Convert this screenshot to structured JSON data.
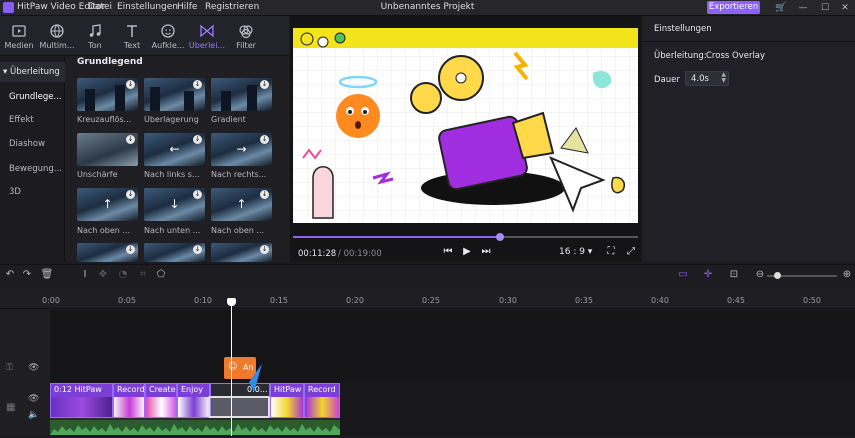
{
  "titlebar": {
    "app_name": "HitPaw Video Editor",
    "menu": [
      "Datei",
      "Einstellungen",
      "Hilfe",
      "Registrieren"
    ],
    "project_title": "Unbenanntes Projekt",
    "export_label": "Exportieren"
  },
  "media_tabs": [
    {
      "label": "Medien",
      "icon": "media-icon"
    },
    {
      "label": "Multim...",
      "icon": "globe-icon"
    },
    {
      "label": "Ton",
      "icon": "music-icon"
    },
    {
      "label": "Text",
      "icon": "text-icon"
    },
    {
      "label": "Aufkle...",
      "icon": "sticker-icon"
    },
    {
      "label": "Überlei...",
      "icon": "transition-icon"
    },
    {
      "label": "Filter",
      "icon": "filter-icon"
    }
  ],
  "categories": {
    "header": "Überleitung",
    "items": [
      "Grundlege...",
      "Effekt",
      "Diashow",
      "Bewegung...",
      "3D"
    ]
  },
  "grid": {
    "heading": "Grundlegend",
    "items": [
      {
        "label": "Kreuzauflös..."
      },
      {
        "label": "Überlagerung"
      },
      {
        "label": "Gradient"
      },
      {
        "label": "Unschärfe"
      },
      {
        "label": "Nach links s..."
      },
      {
        "label": "Nach rechts..."
      },
      {
        "label": "Nach oben ..."
      },
      {
        "label": "Nach unten ..."
      },
      {
        "label": "Nach oben ..."
      }
    ]
  },
  "preview": {
    "current_time": "00:11:28",
    "total_time": "/ 00:19:00",
    "progress": 0.6,
    "aspect_ratio": "16 : 9"
  },
  "settings": {
    "title": "Einstellungen",
    "transition_label": "Überleitung:",
    "transition_value": "Cross Overlay",
    "duration_label": "Dauer",
    "duration_value": "4.0s"
  },
  "timeline": {
    "ticks": [
      "0:00",
      "0:05",
      "0:10",
      "0:15",
      "0:20",
      "0:25",
      "0:30",
      "0:35",
      "0:40",
      "0:45",
      "0:50"
    ],
    "orange_clip_label": "An",
    "clips": [
      {
        "label": "0:12  HitPaw"
      },
      {
        "label": "Record"
      },
      {
        "label": "Create"
      },
      {
        "label": "Enjoy"
      },
      {
        "label": "0:0..."
      },
      {
        "label": "HitPaw"
      },
      {
        "label": "Record"
      }
    ]
  },
  "colors": {
    "accent": "#8b62f7",
    "orange": "#f07a2c",
    "audio": "#2a5c2e"
  }
}
